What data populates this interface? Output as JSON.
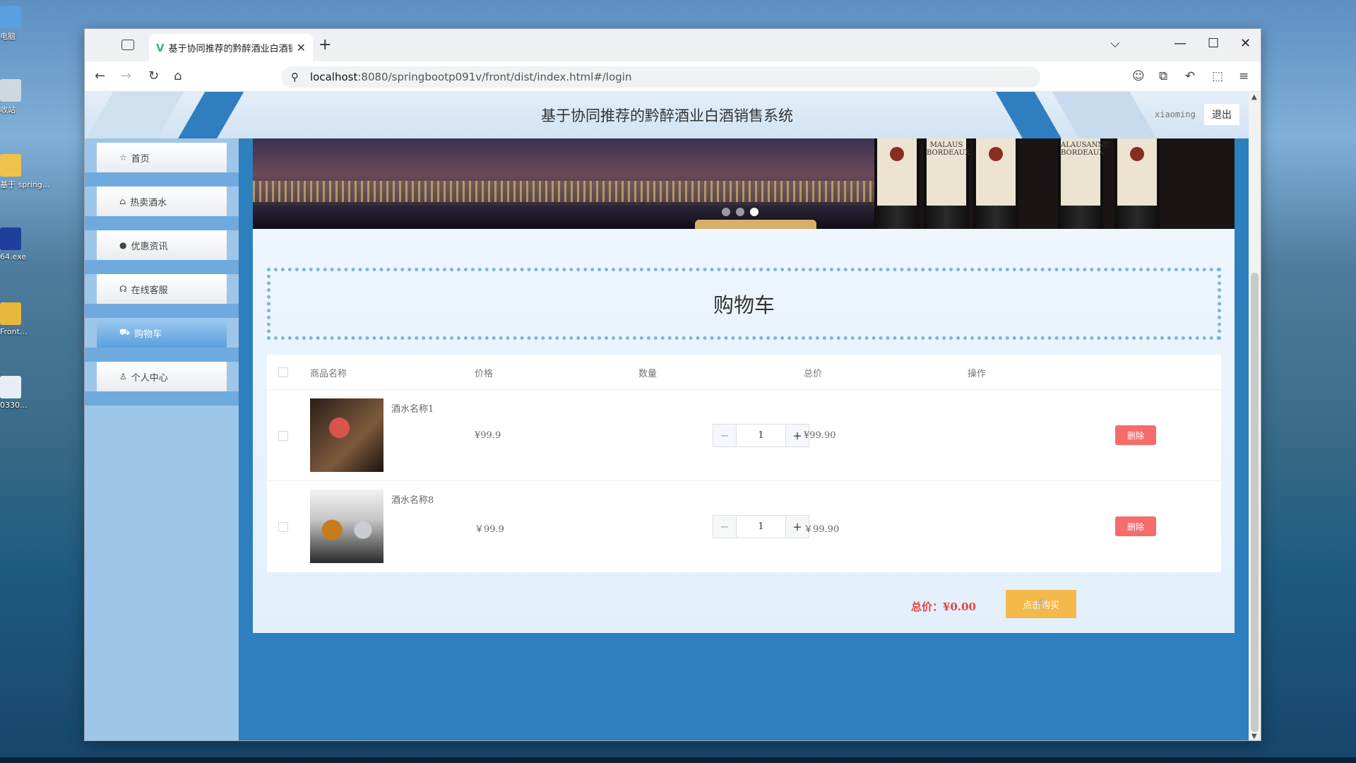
{
  "desktop": {
    "icons": [
      "电脑",
      "收站",
      "基于\nspring...",
      "64.exe",
      "Front...",
      "0330..."
    ]
  },
  "browser": {
    "tab_title": "基于协同推荐的黔醉酒业白酒销",
    "tab_favicon": "V",
    "url_host": "localhost",
    "url_rest": ":8080/springbootp091v/front/dist/index.html#/login",
    "icons": {
      "tab_overview": "tab-overview-icon",
      "new_tab": "+",
      "dropdown": "⌵",
      "minimize": "—",
      "maximize": "☐",
      "close": "✕",
      "back": "←",
      "forward": "→",
      "reload": "↻",
      "home": "⌂",
      "search": "⚲",
      "account": "☺",
      "extensions": "⧉",
      "undo": "↶",
      "puzzle": "⬚",
      "menu": "≡"
    }
  },
  "header": {
    "title": "基于协同推荐的黔醉酒业白酒销售系统",
    "username": "xiaoming",
    "logout": "退出"
  },
  "sidebar": {
    "items": [
      {
        "icon": "☆",
        "label": "首页"
      },
      {
        "icon": "⌂",
        "label": "热卖酒水"
      },
      {
        "icon": "●",
        "label": "优惠资讯"
      },
      {
        "icon": "☊",
        "label": "在线客服"
      },
      {
        "icon": "⛟",
        "label": "购物车"
      },
      {
        "icon": "♙",
        "label": "个人中心"
      }
    ],
    "active_index": 4
  },
  "banner": {
    "bottle_labels": [
      "",
      "MALAUS",
      "",
      "ALAUSANNE",
      ""
    ],
    "bottle_subtext": "BORDEAUX",
    "active_dot": 3,
    "dot_count": 3
  },
  "cart": {
    "title": "购物车",
    "columns": [
      "商品名称",
      "价格",
      "数量",
      "总价",
      "操作"
    ],
    "items": [
      {
        "name": "酒水名称1",
        "price": "¥99.9",
        "qty": "1",
        "total": "¥99.90",
        "action": "删除"
      },
      {
        "name": "酒水名称8",
        "price": "￥99.9",
        "qty": "1",
        "total": "￥99.90",
        "action": "删除"
      }
    ],
    "stepper_minus": "−",
    "stepper_plus": "+",
    "total_label": "总价：¥0.00",
    "buy_label": "点击购买"
  },
  "colors": {
    "accent": "#2e7fbd",
    "delete": "#f56c6c",
    "buy": "#f3b94a",
    "total": "#e64340"
  }
}
